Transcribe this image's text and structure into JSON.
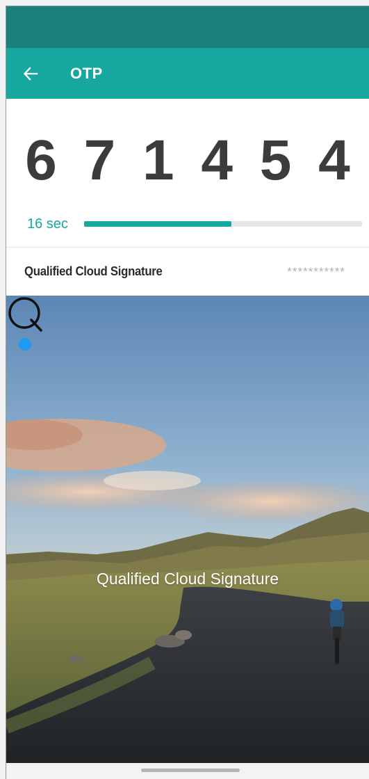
{
  "app_bar": {
    "title": "OTP",
    "back_icon": "arrow-left-icon"
  },
  "otp": {
    "code": "671454",
    "code_display": "6 7 1 4 5 4",
    "timer_label": "16 sec",
    "progress_fraction": 0.53
  },
  "account": {
    "name": "Qualified Cloud Signature",
    "masked_value": "***********"
  },
  "hero": {
    "brand_name": "Qualified Cloud Signature",
    "logo_icon": "q-logo-icon"
  },
  "colors": {
    "status_bar": "#1a807c",
    "primary": "#16a8a0",
    "otp_text": "#3c3c3c",
    "accent_dot": "#1e9bf0"
  }
}
